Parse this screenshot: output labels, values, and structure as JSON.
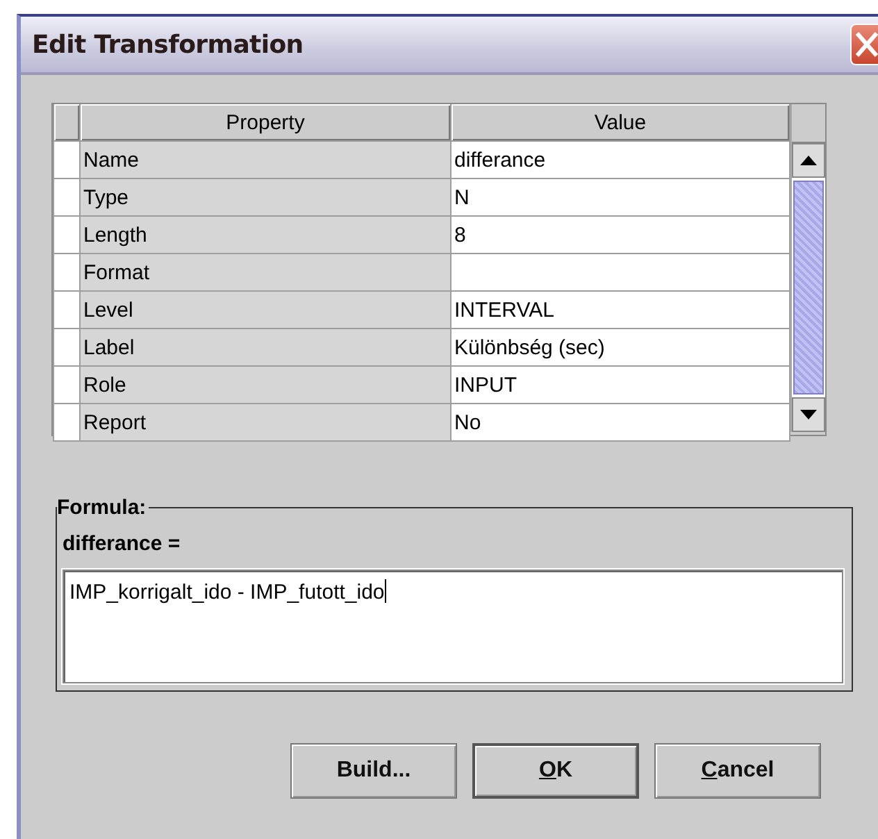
{
  "window": {
    "title": "Edit Transformation"
  },
  "table": {
    "columns": [
      "Property",
      "Value"
    ],
    "rows": [
      {
        "property": "Name",
        "value": "differance"
      },
      {
        "property": "Type",
        "value": "N"
      },
      {
        "property": "Length",
        "value": "8"
      },
      {
        "property": "Format"
      },
      {
        "property": "Level",
        "value": "INTERVAL"
      },
      {
        "property": "Label",
        "value": "Különbség (sec)"
      },
      {
        "property": "Role",
        "value": "INPUT"
      },
      {
        "property": "Report",
        "value": "No"
      }
    ]
  },
  "formula": {
    "title": "Formula:",
    "variable": "differance =",
    "value": "IMP_korrigalt_ido - IMP_futott_ido",
    "focused": true
  },
  "buttons": [
    {
      "label": "Build...",
      "default": false
    },
    {
      "mnemonic": "O",
      "label": "K",
      "default": true
    },
    {
      "mnemonic": "C",
      "label": "ancel",
      "default": false
    }
  ]
}
